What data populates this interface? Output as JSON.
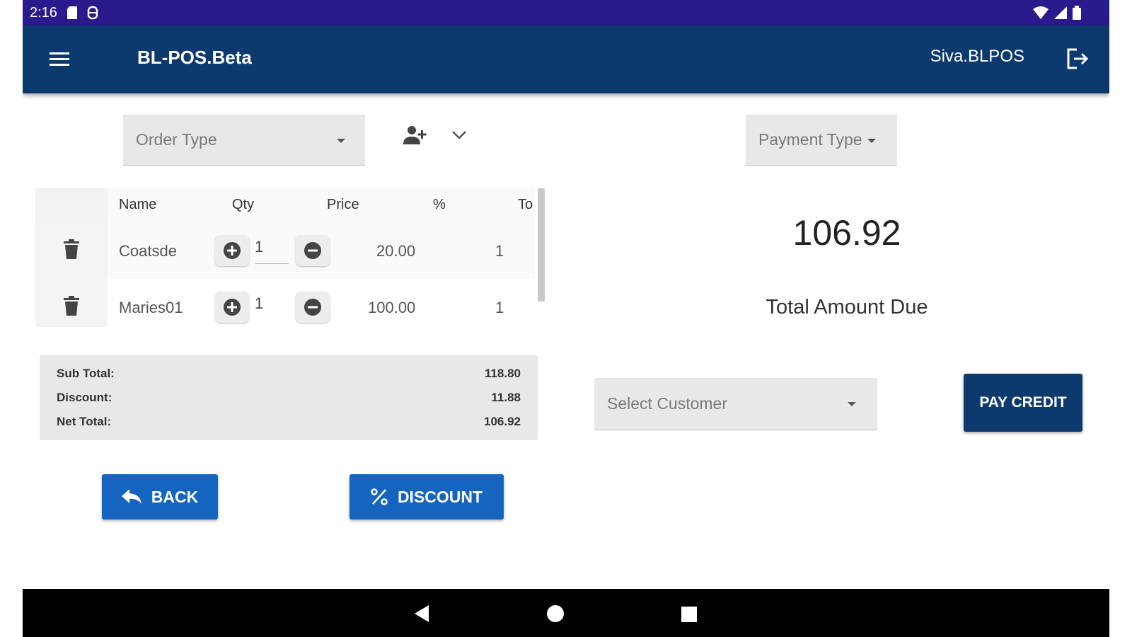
{
  "status_bar": {
    "time": "2:16"
  },
  "app_bar": {
    "title": "BL-POS.Beta",
    "user": "Siva.BLPOS"
  },
  "order": {
    "order_type_placeholder": "Order Type",
    "payment_type_placeholder": "Payment Type"
  },
  "table": {
    "headers": {
      "name": "Name",
      "qty": "Qty",
      "price": "Price",
      "percent": "%",
      "total": "To"
    },
    "rows": [
      {
        "name": "Coatsde",
        "qty": "1",
        "price": "20.00",
        "percent": "",
        "total": "1"
      },
      {
        "name": "Maries01",
        "qty": "1",
        "price": "100.00",
        "percent": "",
        "total": "1"
      }
    ]
  },
  "summary": {
    "sub_total_label": "Sub Total:",
    "sub_total": "118.80",
    "discount_label": "Discount:",
    "discount": "11.88",
    "net_total_label": "Net Total:",
    "net_total": "106.92"
  },
  "buttons": {
    "back": "BACK",
    "discount": "DISCOUNT",
    "pay_credit": "PAY CREDIT"
  },
  "payment": {
    "amount_due": "106.92",
    "amount_due_label": "Total Amount Due",
    "customer_placeholder": "Select Customer"
  },
  "colors": {
    "status_bar": "#2a1b8c",
    "app_bar": "#0c3a6e",
    "primary_button": "#1565c0"
  }
}
